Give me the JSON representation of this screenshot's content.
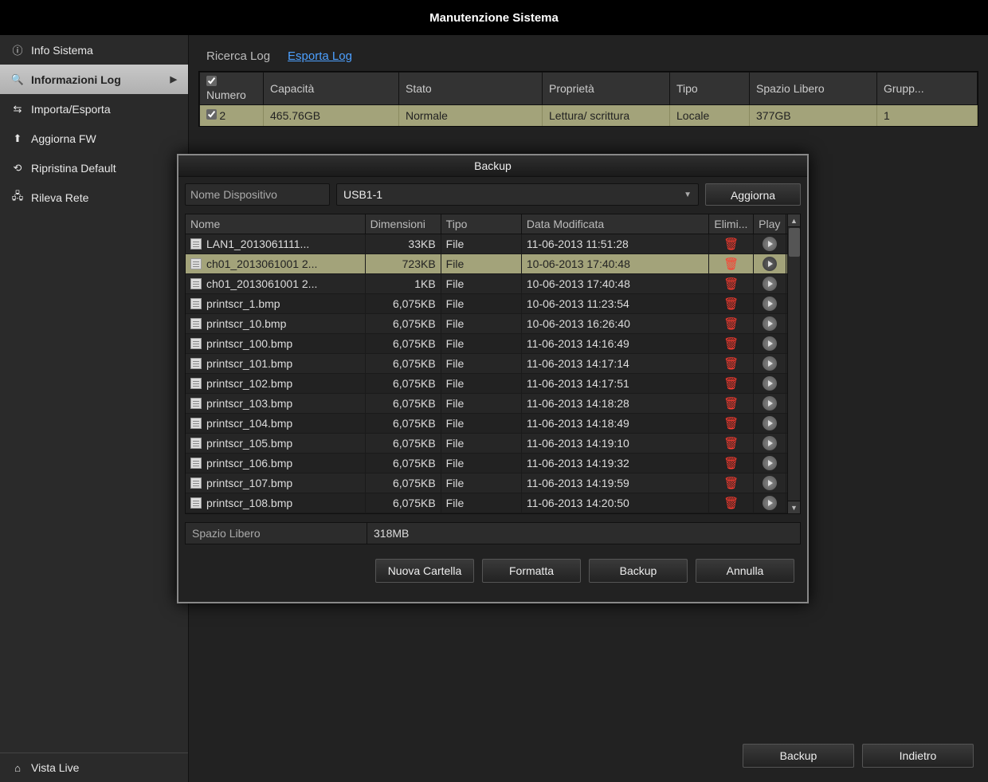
{
  "window_title": "Manutenzione Sistema",
  "sidebar": {
    "items": [
      {
        "label": "Info Sistema",
        "icon": "info"
      },
      {
        "label": "Informazioni Log",
        "icon": "search",
        "active": true,
        "chevron": true
      },
      {
        "label": "Importa/Esporta",
        "icon": "swap"
      },
      {
        "label": "Aggiorna FW",
        "icon": "upload"
      },
      {
        "label": "Ripristina Default",
        "icon": "reset"
      },
      {
        "label": "Rileva Rete",
        "icon": "network"
      }
    ],
    "footer_label": "Vista Live"
  },
  "tabs": {
    "search": "Ricerca Log",
    "export": "Esporta Log"
  },
  "log_table": {
    "headers": {
      "number": "Numero",
      "capacity": "Capacità",
      "status": "Stato",
      "property": "Proprietà",
      "type": "Tipo",
      "free": "Spazio Libero",
      "group": "Grupp..."
    },
    "row": {
      "number": "2",
      "capacity": "465.76GB",
      "status": "Normale",
      "property": "Lettura/ scrittura",
      "type": "Locale",
      "free": "377GB",
      "group": "1"
    }
  },
  "dialog": {
    "title": "Backup",
    "device_label": "Nome Dispositivo",
    "device_value": "USB1-1",
    "refresh": "Aggiorna",
    "headers": {
      "name": "Nome",
      "size": "Dimensioni",
      "type": "Tipo",
      "date": "Data Modificata",
      "del": "Elimi...",
      "play": "Play"
    },
    "files": [
      {
        "name": "LAN1_2013061111...",
        "size": "33KB",
        "type": "File",
        "date": "11-06-2013 11:51:28"
      },
      {
        "name": "ch01_2013061001 2...",
        "size": "723KB",
        "type": "File",
        "date": "10-06-2013 17:40:48",
        "selected": true
      },
      {
        "name": "ch01_2013061001 2...",
        "size": "1KB",
        "type": "File",
        "date": "10-06-2013 17:40:48"
      },
      {
        "name": "printscr_1.bmp",
        "size": "6,075KB",
        "type": "File",
        "date": "10-06-2013 11:23:54"
      },
      {
        "name": "printscr_10.bmp",
        "size": "6,075KB",
        "type": "File",
        "date": "10-06-2013 16:26:40"
      },
      {
        "name": "printscr_100.bmp",
        "size": "6,075KB",
        "type": "File",
        "date": "11-06-2013 14:16:49"
      },
      {
        "name": "printscr_101.bmp",
        "size": "6,075KB",
        "type": "File",
        "date": "11-06-2013 14:17:14"
      },
      {
        "name": "printscr_102.bmp",
        "size": "6,075KB",
        "type": "File",
        "date": "11-06-2013 14:17:51"
      },
      {
        "name": "printscr_103.bmp",
        "size": "6,075KB",
        "type": "File",
        "date": "11-06-2013 14:18:28"
      },
      {
        "name": "printscr_104.bmp",
        "size": "6,075KB",
        "type": "File",
        "date": "11-06-2013 14:18:49"
      },
      {
        "name": "printscr_105.bmp",
        "size": "6,075KB",
        "type": "File",
        "date": "11-06-2013 14:19:10"
      },
      {
        "name": "printscr_106.bmp",
        "size": "6,075KB",
        "type": "File",
        "date": "11-06-2013 14:19:32"
      },
      {
        "name": "printscr_107.bmp",
        "size": "6,075KB",
        "type": "File",
        "date": "11-06-2013 14:19:59"
      },
      {
        "name": "printscr_108.bmp",
        "size": "6,075KB",
        "type": "File",
        "date": "11-06-2013 14:20:50"
      }
    ],
    "free_label": "Spazio Libero",
    "free_value": "318MB",
    "buttons": {
      "new_folder": "Nuova Cartella",
      "format": "Formatta",
      "backup": "Backup",
      "cancel": "Annulla"
    }
  },
  "footer": {
    "backup": "Backup",
    "back": "Indietro"
  }
}
